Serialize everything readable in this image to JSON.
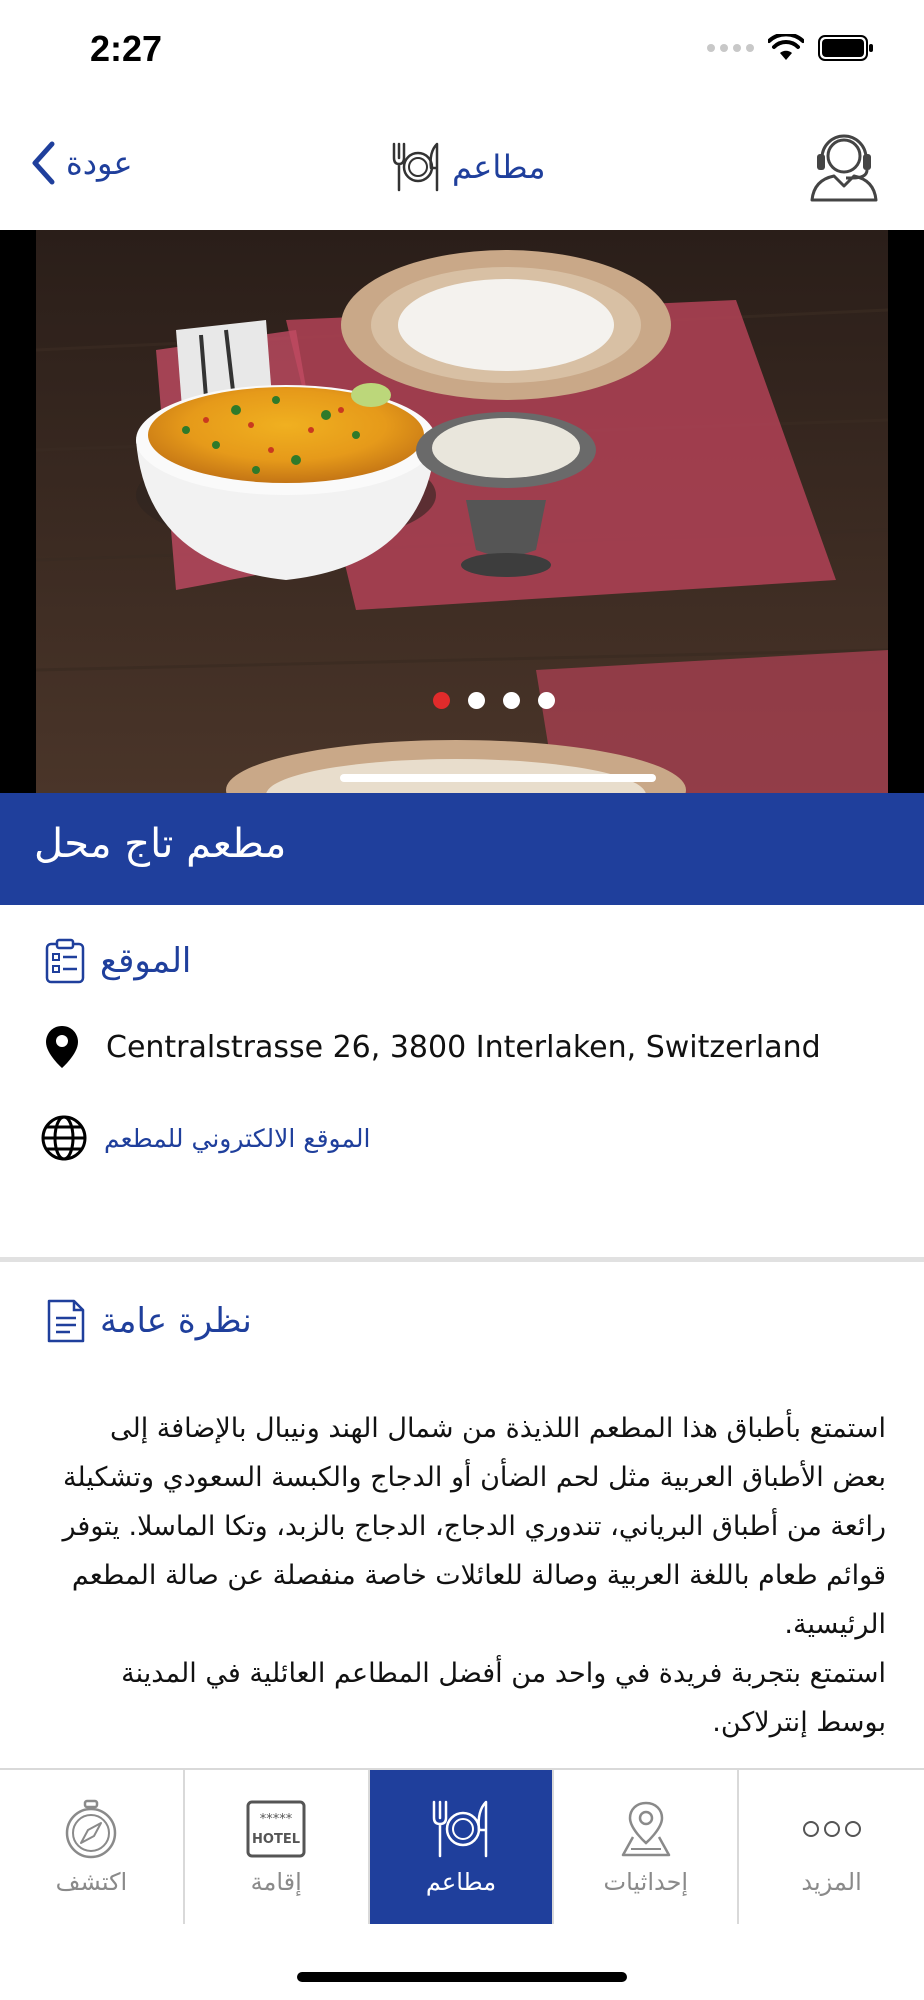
{
  "status_bar": {
    "time": "2:27"
  },
  "nav": {
    "back_label": "عودة",
    "title": "مطاعم"
  },
  "hero": {
    "slide_count": 4,
    "active_slide": 1
  },
  "restaurant": {
    "name": "مطعم تاج محل"
  },
  "location": {
    "title": "الموقع",
    "address": "Centralstrasse 26, 3800 Interlaken, Switzerland",
    "website_label": "الموقع الالكتروني للمطعم"
  },
  "overview": {
    "title": "نظرة عامة",
    "paragraphs": [
      "استمتع بأطباق هذا المطعم اللذيذة من شمال الهند ونيبال بالإضافة إلى بعض الأطباق العربية مثل لحم الضأن أو الدجاج والكبسة السعودي وتشكيلة رائعة من أطباق البرياني، تندوري الدجاج، الدجاج بالزبد، وتكا الماسلا. يتوفر قوائم طعام باللغة العربية وصالة للعائلات خاصة منفصلة عن صالة المطعم الرئيسية.",
      "استمتع بتجربة فريدة في واحد من أفضل المطاعم العائلية في المدينة بوسط إنترلاكن."
    ]
  },
  "tabs": [
    {
      "label": "اكتشف",
      "icon": "compass-icon",
      "active": false
    },
    {
      "label": "إقامة",
      "icon": "hotel-icon",
      "active": false
    },
    {
      "label": "مطاعم",
      "icon": "restaurant-icon",
      "active": true
    },
    {
      "label": "إحداثيات",
      "icon": "map-pin-icon",
      "active": false
    },
    {
      "label": "المزيد",
      "icon": "more-icon",
      "active": false
    }
  ],
  "colors": {
    "primary": "#1f3f9c",
    "active_dot": "#e02b2b",
    "tab_inactive": "#8a8a8a"
  }
}
